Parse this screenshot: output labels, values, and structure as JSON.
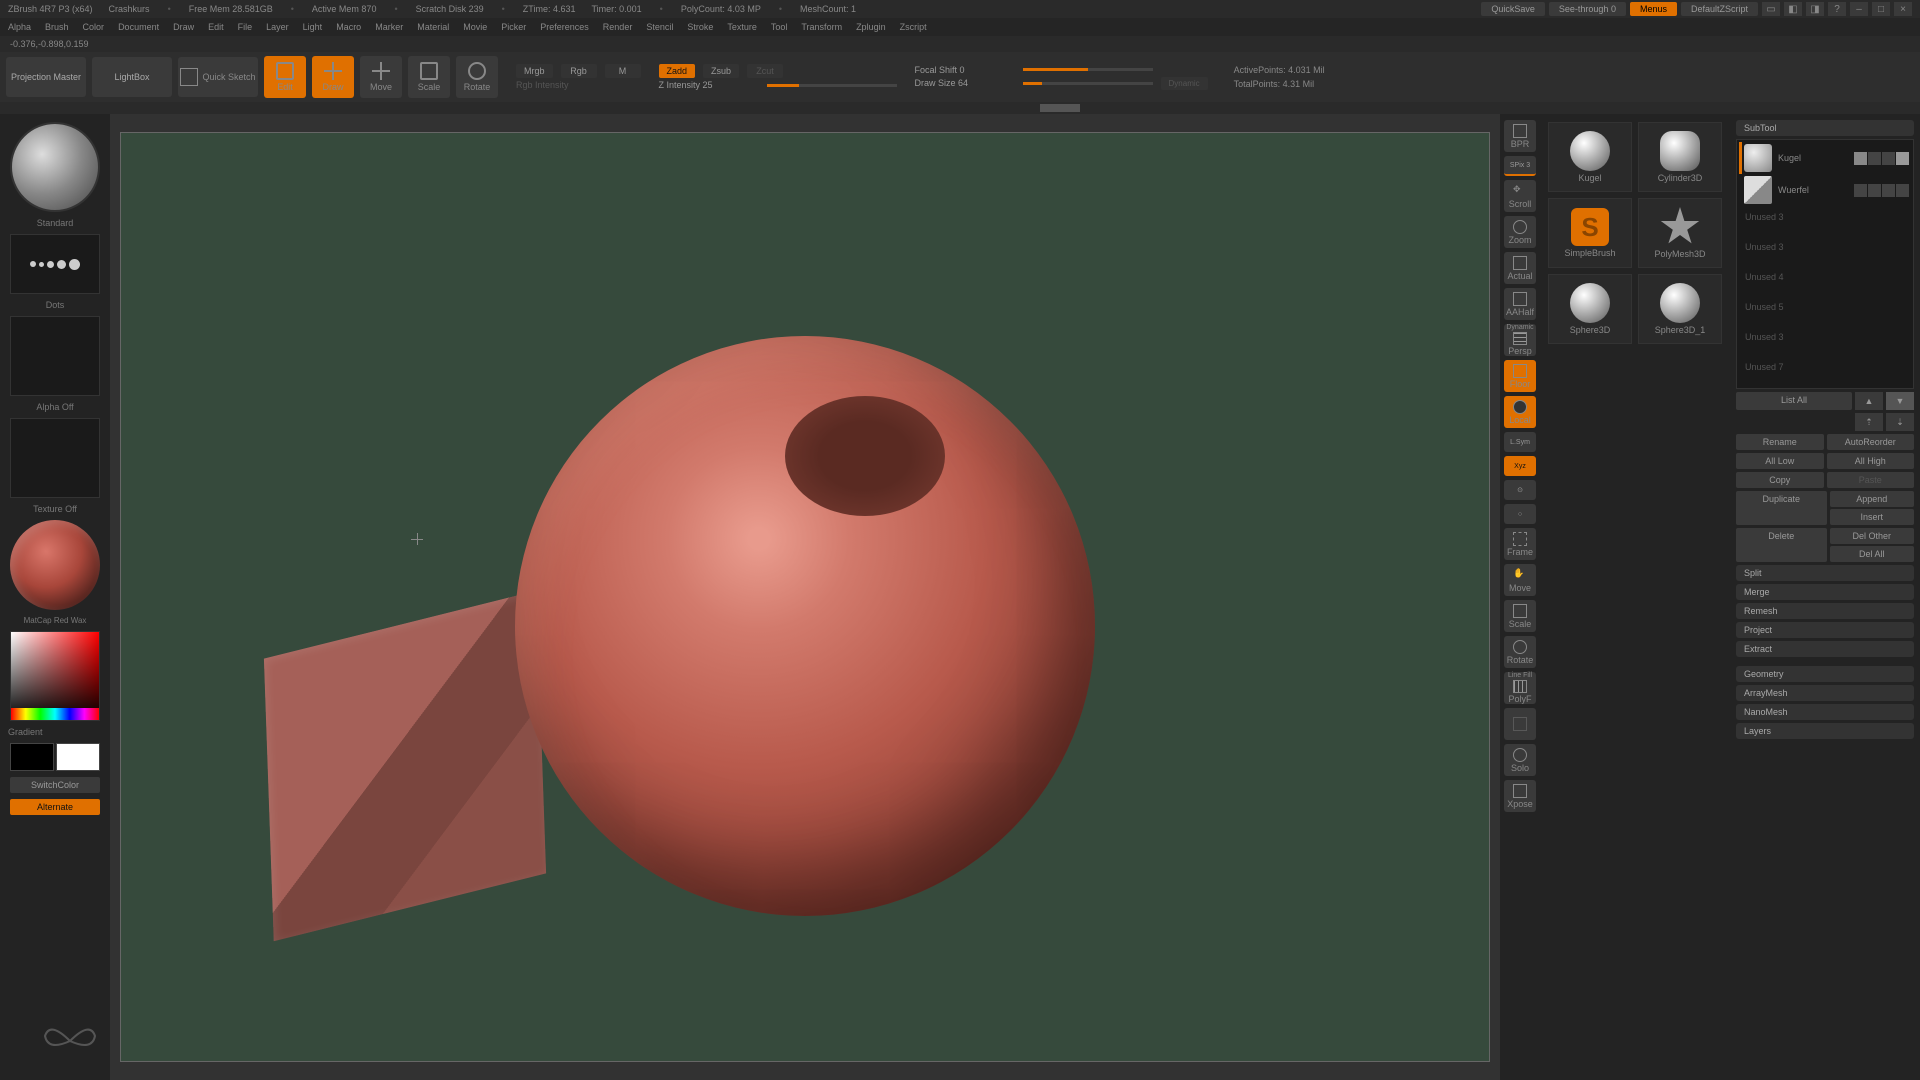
{
  "title": {
    "app": "ZBrush 4R7 P3 (x64)",
    "project": "Crashkurs",
    "freemem": "Free Mem 28.581GB",
    "activemem": "Active Mem 870",
    "scratch": "Scratch Disk 239",
    "ztime": "ZTime: 4.631",
    "timer": "Timer: 0.001",
    "polycount": "PolyCount: 4.03 MP",
    "meshcount": "MeshCount: 1",
    "quicksave": "QuickSave",
    "seethrough": "See-through  0",
    "menus": "Menus",
    "script": "DefaultZScript"
  },
  "menu": [
    "Alpha",
    "Brush",
    "Color",
    "Document",
    "Draw",
    "Edit",
    "File",
    "Layer",
    "Light",
    "Macro",
    "Marker",
    "Material",
    "Movie",
    "Picker",
    "Preferences",
    "Render",
    "Stencil",
    "Stroke",
    "Texture",
    "Tool",
    "Transform",
    "Zplugin",
    "Zscript"
  ],
  "coords": "-0.376,-0.898,0.159",
  "toolbar": {
    "projection": "Projection Master",
    "lightbox": "LightBox",
    "quicksketch": "Quick Sketch",
    "edit": "Edit",
    "draw": "Draw",
    "move": "Move",
    "scale": "Scale",
    "rotate": "Rotate",
    "mrgb": "Mrgb",
    "rgb": "Rgb",
    "m": "M",
    "rgbint": "Rgb Intensity",
    "zadd": "Zadd",
    "zsub": "Zsub",
    "zcut": "Zcut",
    "zint": "Z Intensity 25",
    "focal": "Focal Shift 0",
    "drawsize": "Draw Size 64",
    "dynamic": "Dynamic",
    "activepts": "ActivePoints: 4.031 Mil",
    "totalpts": "TotalPoints: 4.31 Mil"
  },
  "left": {
    "brush": "Standard",
    "stroke": "Dots",
    "alpha": "Alpha Off",
    "texture": "Texture Off",
    "material": "MatCap Red Wax",
    "gradient": "Gradient",
    "switch": "SwitchColor",
    "alternate": "Alternate"
  },
  "nav": {
    "bpr": "BPR",
    "spix": "SPix 3",
    "scroll": "Scroll",
    "zoom": "Zoom",
    "actual": "Actual",
    "aahalf": "AAHalf",
    "persp": "Persp",
    "floor": "Floor",
    "local": "Local",
    "lsym": "L.Sym",
    "xyz": "Xyz",
    "frame": "Frame",
    "move": "Move",
    "scale": "Scale",
    "rotate": "Rotate",
    "linefill": "Line Fill",
    "polyf": "PolyF",
    "solo": "Solo",
    "xpose": "Xpose",
    "dynamic": "Dynamic"
  },
  "tools": {
    "kugel": "Kugel",
    "cylinder": "Cylinder3D",
    "simplebrush": "SimpleBrush",
    "polymesh": "PolyMesh3D",
    "sphere3d": "Sphere3D",
    "sphere3d1": "Sphere3D_1"
  },
  "subtool": {
    "header": "SubTool",
    "kugel": "Kugel",
    "wuerfel": "Wuerfel",
    "slots": [
      "Unused 3",
      "Unused 3",
      "Unused 4",
      "Unused 5",
      "Unused 3",
      "Unused 7"
    ],
    "listall": "List All",
    "rename": "Rename",
    "autoreorder": "AutoReorder",
    "alllow": "All Low",
    "allhigh": "All High",
    "copy": "Copy",
    "paste": "Paste",
    "duplicate": "Duplicate",
    "append": "Append",
    "insert": "Insert",
    "delete": "Delete",
    "delother": "Del Other",
    "delall": "Del All",
    "split": "Split",
    "merge": "Merge",
    "remesh": "Remesh",
    "project": "Project",
    "extract": "Extract",
    "geometry": "Geometry",
    "arraymesh": "ArrayMesh",
    "nanomesh": "NanoMesh",
    "layers": "Layers"
  }
}
